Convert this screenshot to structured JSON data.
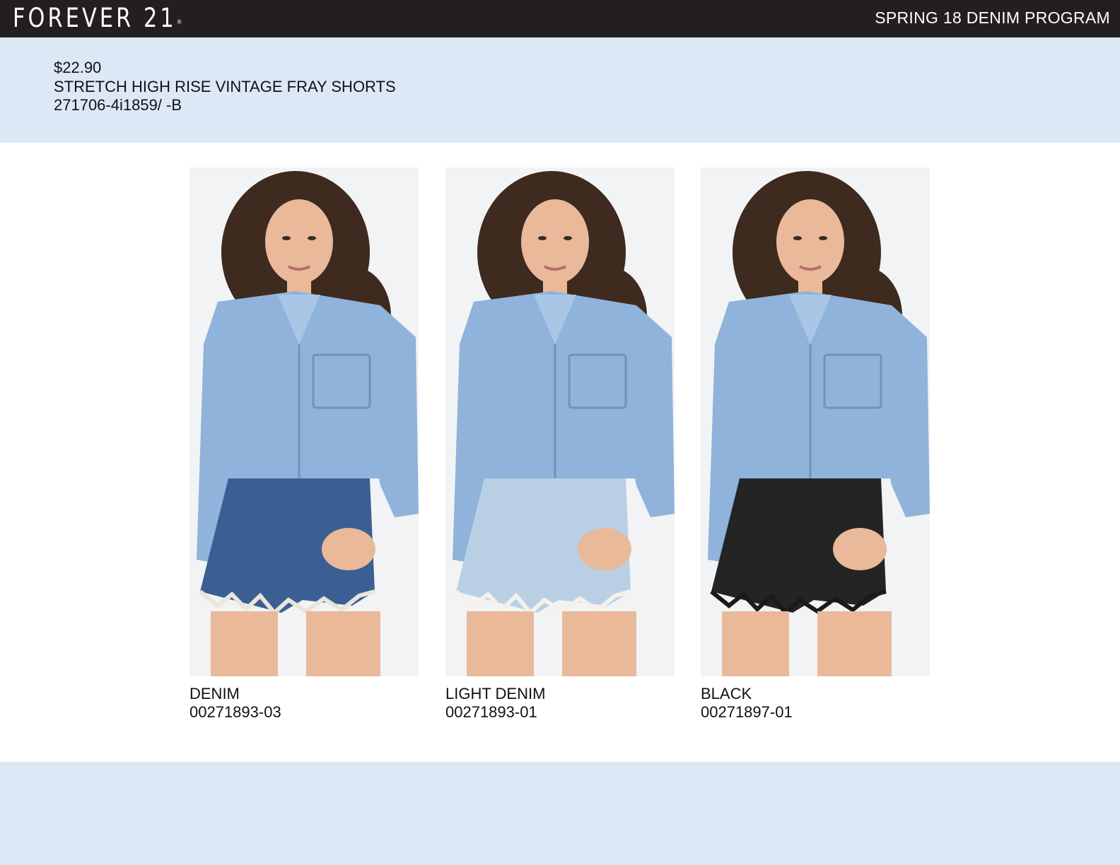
{
  "header": {
    "brand": "FOREVER 21",
    "brand_mark": "®",
    "program": "SPRING 18 DENIM PROGRAM"
  },
  "product": {
    "price": "$22.90",
    "name": "STRETCH HIGH RISE VINTAGE FRAY SHORTS",
    "style_code": "271706-4i1859/ -B"
  },
  "variants": [
    {
      "color_name": "DENIM",
      "sku": "00271893-03",
      "shorts_color": "#3b5f93",
      "fray_color": "#e9e4dc"
    },
    {
      "color_name": "LIGHT DENIM",
      "sku": "00271893-01",
      "shorts_color": "#b9d0e4",
      "fray_color": "#f4f1ea"
    },
    {
      "color_name": "BLACK",
      "sku": "00271897-01",
      "shorts_color": "#242424",
      "fray_color": "#1a1a1a"
    }
  ],
  "colors": {
    "bar": "#231f20",
    "band": "#dce8f6",
    "shirt": "#8fb3da",
    "hair": "#3e2a1e",
    "skin": "#e9b99a"
  }
}
